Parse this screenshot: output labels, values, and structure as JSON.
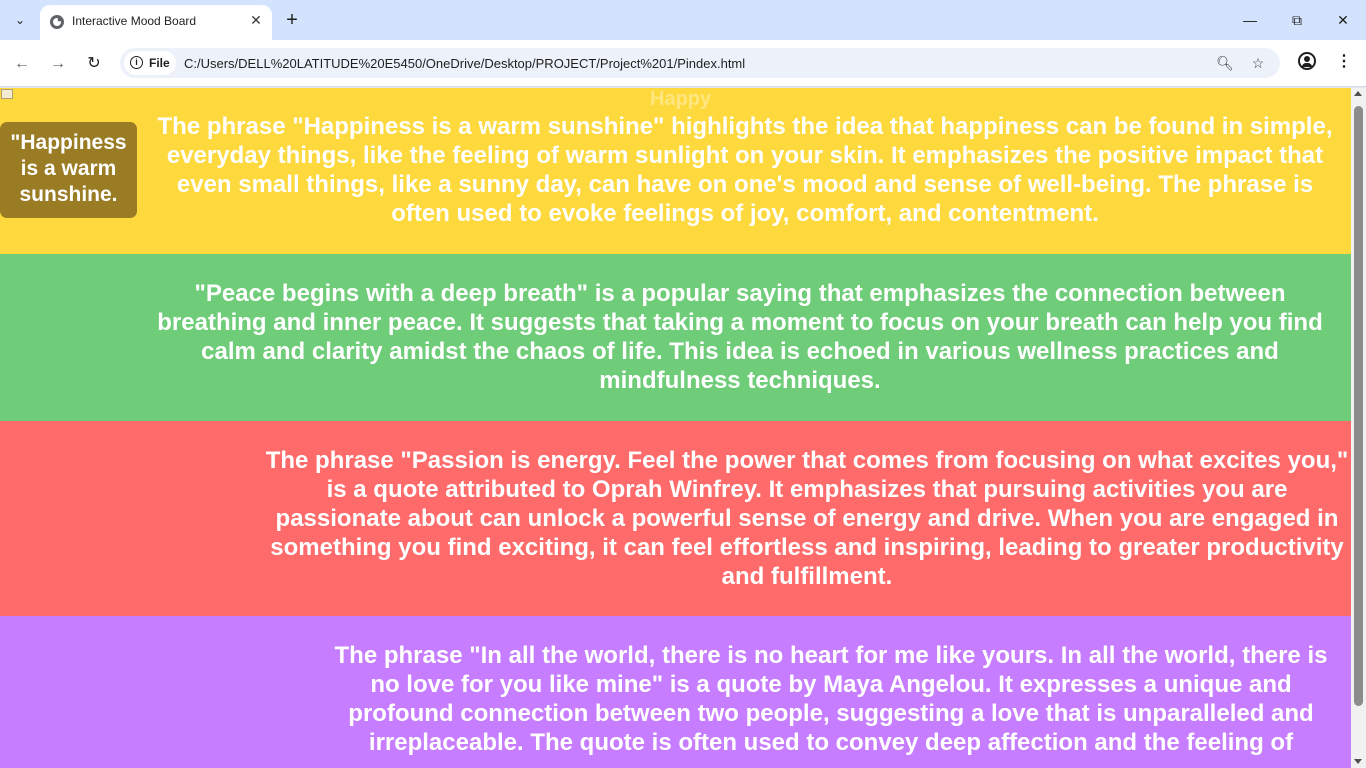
{
  "browser": {
    "tab_title": "Interactive Mood Board",
    "site_chip_label": "File",
    "url": "C:/Users/DELL%20LATITUDE%20E5450/OneDrive/Desktop/PROJECT/Project%201/Pindex.html",
    "icons": {
      "tab_search": "chevron-down-icon",
      "favicon": "globe-icon",
      "tab_close": "close-icon",
      "new_tab": "plus-icon",
      "back": "arrow-left-icon",
      "forward": "arrow-right-icon",
      "reload": "reload-icon",
      "site_info": "info-icon",
      "zoom": "zoom-icon",
      "bookmark": "star-icon",
      "profile": "profile-icon",
      "menu": "kebab-menu-icon",
      "minimize": "minimize-icon",
      "maximize": "restore-icon",
      "close_window": "close-icon"
    }
  },
  "page": {
    "happy_image_alt": "Happy",
    "sections": [
      {
        "id": "happiness",
        "color": "#fdd93e",
        "card_text": "\"Happiness is a warm sunshine.",
        "text": "The phrase \"Happiness is a warm sunshine\" highlights the idea that happiness can be found in simple, everyday things, like the feeling of warm sunlight on your skin. It emphasizes the positive impact that even small things, like a sunny day, can have on one's mood and sense of well-being. The phrase is often used to evoke feelings of joy, comfort, and contentment."
      },
      {
        "id": "peace",
        "color": "#6fcd79",
        "text": "\"Peace begins with a deep breath\" is a popular saying that emphasizes the connection between breathing and inner peace. It suggests that taking a moment to focus on your breath can help you find calm and clarity amidst the chaos of life. This idea is echoed in various wellness practices and mindfulness techniques."
      },
      {
        "id": "passion",
        "color": "#ff6a6a",
        "text": "The phrase \"Passion is energy. Feel the power that comes from focusing on what excites you,\" is a quote attributed to Oprah Winfrey. It emphasizes that pursuing activities you are passionate about can unlock a powerful sense of energy and drive. When you are engaged in something you find exciting, it can feel effortless and inspiring, leading to greater productivity and fulfillment."
      },
      {
        "id": "love",
        "color": "#c77dff",
        "text": "The phrase \"In all the world, there is no heart for me like yours. In all the world, there is no love for you like mine\" is a quote by Maya Angelou. It expresses a unique and profound connection between two people, suggesting a love that is unparalleled and irreplaceable. The quote is often used to convey deep affection and the feeling of"
      }
    ]
  }
}
